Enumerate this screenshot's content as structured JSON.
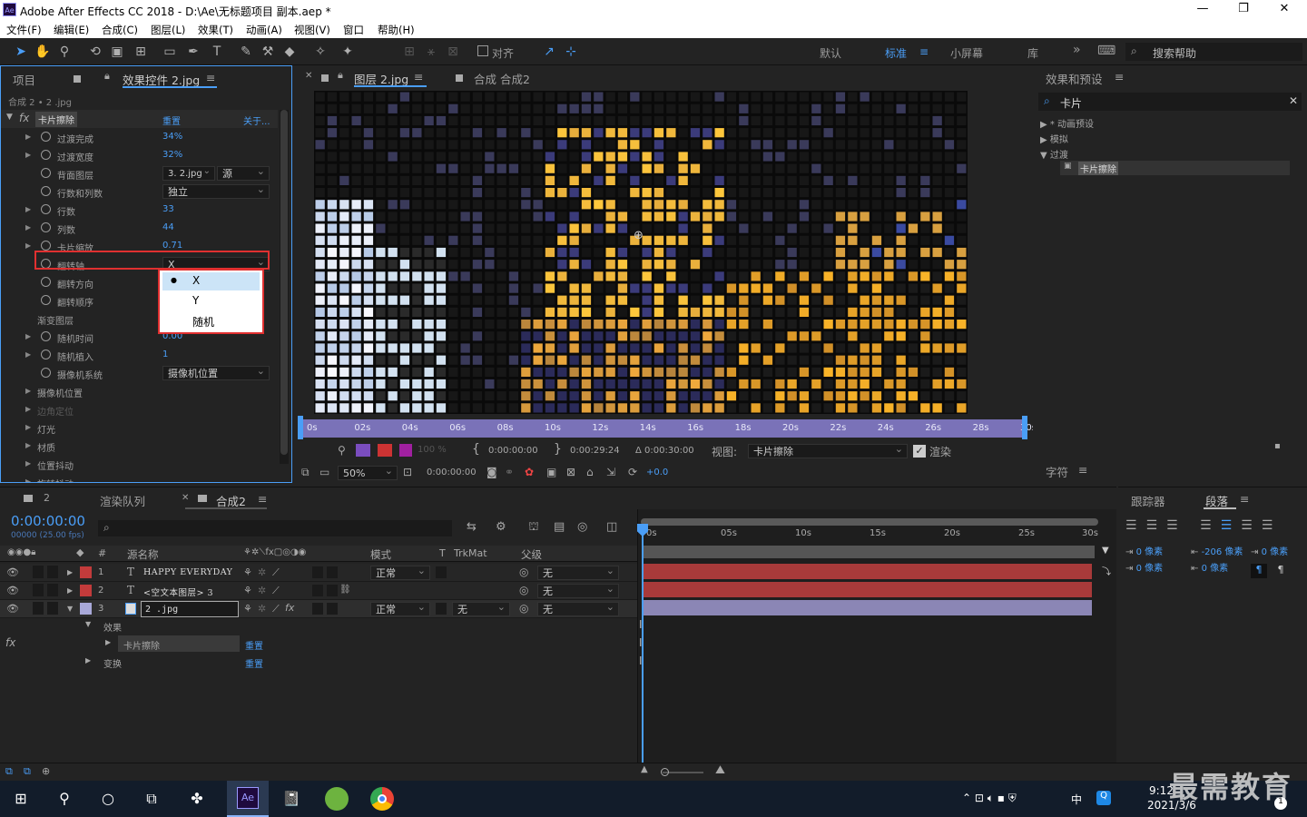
{
  "window": {
    "app_badge": "Ae",
    "title": "Adobe After Effects CC 2018 - D:\\Ae\\无标题项目 副本.aep *",
    "min": "—",
    "max": "❐",
    "close": "✕"
  },
  "menu": [
    "文件(F)",
    "编辑(E)",
    "合成(C)",
    "图层(L)",
    "效果(T)",
    "动画(A)",
    "视图(V)",
    "窗口",
    "帮助(H)"
  ],
  "toolbar": {
    "snap_label": "对齐",
    "workspaces": [
      "默认",
      "标准",
      "小屏幕",
      "库"
    ],
    "active_workspace": "标准",
    "more": "»",
    "search_placeholder": "搜索帮助"
  },
  "left_panel": {
    "tab_project": "项目",
    "tab_effects": "效果控件 2.jpg",
    "breadcrumb": "合成 2 • 2 .jpg",
    "effect_name": "卡片擦除",
    "reset": "重置",
    "about": "关于...",
    "props": [
      {
        "label": "过渡完成",
        "value": "34%",
        "type": "num"
      },
      {
        "label": "过渡宽度",
        "value": "32%",
        "type": "num"
      },
      {
        "label": "背面图层",
        "value": "3. 2.jpg",
        "value2": "源",
        "type": "dd2"
      },
      {
        "label": "行数和列数",
        "value": "独立",
        "type": "dd"
      },
      {
        "label": "行数",
        "value": "33",
        "type": "num"
      },
      {
        "label": "列数",
        "value": "44",
        "type": "num"
      },
      {
        "label": "卡片缩放",
        "value": "0.71",
        "type": "num"
      },
      {
        "label": "翻转轴",
        "value": "X",
        "type": "dd"
      },
      {
        "label": "翻转方向",
        "value": "",
        "type": "num"
      },
      {
        "label": "翻转顺序",
        "value": "",
        "type": "num"
      },
      {
        "label": "渐变图层",
        "value": "",
        "type": "plain"
      },
      {
        "label": "随机时间",
        "value": "0.00",
        "type": "num"
      },
      {
        "label": "随机植入",
        "value": "1",
        "type": "num"
      },
      {
        "label": "摄像机系统",
        "value": "摄像机位置",
        "type": "dd"
      },
      {
        "label": "摄像机位置",
        "value": "",
        "type": "group"
      },
      {
        "label": "边角定位",
        "value": "",
        "type": "groupdim"
      },
      {
        "label": "灯光",
        "value": "",
        "type": "group"
      },
      {
        "label": "材质",
        "value": "",
        "type": "group"
      },
      {
        "label": "位置抖动",
        "value": "",
        "type": "group"
      },
      {
        "label": "旋转抖动",
        "value": "",
        "type": "group"
      }
    ],
    "popup": {
      "items": [
        "X",
        "Y",
        "随机"
      ],
      "selected": "X"
    }
  },
  "viewer": {
    "tab_layer": "图层 2.jpg",
    "tab_comp": "合成 合成2",
    "ruler": [
      "0s",
      "02s",
      "04s",
      "06s",
      "08s",
      "10s",
      "12s",
      "14s",
      "16s",
      "18s",
      "20s",
      "22s",
      "24s",
      "26s",
      "28s",
      "30s"
    ],
    "zoom_dim": "100 %",
    "time_in": "0:00:00:00",
    "time_out": "0:00:29:24",
    "duration": "Δ 0:00:30:00",
    "view_label": "视图:",
    "view_value": "卡片擦除",
    "render_label": "渲染",
    "zoom": "50%",
    "current_time": "0:00:00:00",
    "exposure": "+0.0"
  },
  "right_panel": {
    "title": "效果和预设",
    "search": "卡片",
    "tree": [
      "* 动画预设",
      "模拟",
      "过渡"
    ],
    "selected_item": "卡片擦除",
    "char_title": "字符"
  },
  "timeline": {
    "tab_render": "渲染队列",
    "tab_comp": "合成2",
    "tab_num": "2",
    "timecode": "0:00:00:00",
    "fps": "00000 (25.00 fps)",
    "headers": {
      "num": "#",
      "name": "源名称",
      "mode": "模式",
      "t": "T",
      "trkmat": "TrkMat",
      "parent": "父级"
    },
    "layers": [
      {
        "num": "1",
        "type": "T",
        "name": "HAPPY EVERYDAY",
        "mode": "正常",
        "trkmat": "",
        "parent": "无",
        "color": "#c33b3b"
      },
      {
        "num": "2",
        "type": "T",
        "name": "<空文本图层> 3",
        "mode": "",
        "trkmat": "",
        "parent": "无",
        "color": "#c33b3b"
      },
      {
        "num": "3",
        "type": "img",
        "name": "2 .jpg",
        "mode": "正常",
        "trkmat": "无",
        "parent": "无",
        "color": "#a8a8d8"
      }
    ],
    "sub": {
      "effects": "效果",
      "effect_item": "卡片擦除",
      "transform": "变换",
      "reset": "重置"
    },
    "ruler": [
      "0s",
      "05s",
      "10s",
      "15s",
      "20s",
      "25s",
      "30s"
    ]
  },
  "right_bottom": {
    "tab_tracker": "跟踪器",
    "tab_paragraph": "段落",
    "px1": "0 像素",
    "px2": "-206 像素",
    "px3": "0 像素",
    "px4": "0 像素",
    "px5": "0 像素"
  },
  "taskbar": {
    "time": "9:12",
    "date": "2021/3/6",
    "ime": "中",
    "watermark": "最需教育",
    "badge": "1"
  }
}
